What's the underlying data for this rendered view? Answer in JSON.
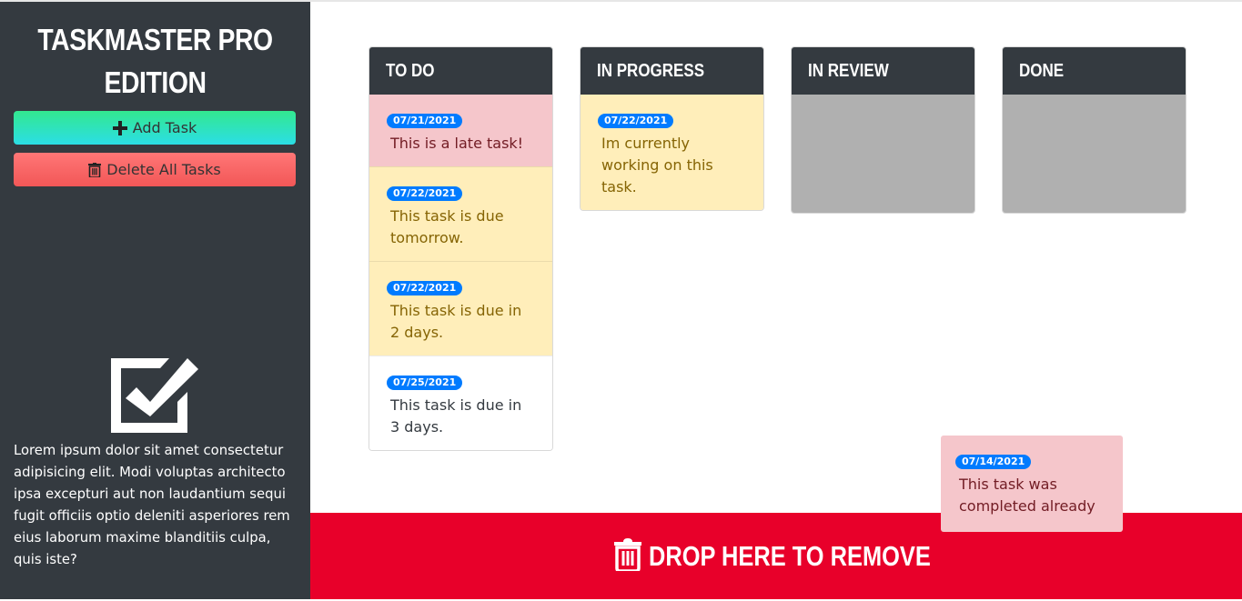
{
  "app": {
    "title_line1": "TASKMASTER PRO",
    "title_line2": "EDITION"
  },
  "sidebar": {
    "add_label": "Add Task",
    "delete_label": "Delete All Tasks",
    "description": "Lorem ipsum dolor sit amet consectetur adipisicing elit. Modi voluptas architecto ipsa excepturi aut non laudantium sequi fugit officiis optio deleniti asperiores rem eius laborum maxime blanditiis culpa, quis iste?"
  },
  "columns": [
    {
      "title": "TO DO",
      "cards": [
        {
          "date": "07/21/2021",
          "text": "This is a late task!",
          "status": "late"
        },
        {
          "date": "07/22/2021",
          "text": "This task is due tomorrow.",
          "status": "soon"
        },
        {
          "date": "07/22/2021",
          "text": "This task is due in 2 days.",
          "status": "soon"
        },
        {
          "date": "07/25/2021",
          "text": "This task is due in 3 days.",
          "status": "ok"
        }
      ]
    },
    {
      "title": "IN PROGRESS",
      "cards": [
        {
          "date": "07/22/2021",
          "text": "Im currently working on this task.",
          "status": "soon"
        }
      ]
    },
    {
      "title": "IN REVIEW",
      "cards": []
    },
    {
      "title": "DONE",
      "cards": []
    }
  ],
  "dragging_card": {
    "date": "07/14/2021",
    "text": "This task was completed already"
  },
  "drop_zone": {
    "label": "DROP HERE TO REMOVE"
  },
  "icons": {
    "add": "plus-icon",
    "delete": "trash-icon",
    "logo": "checkbox-icon",
    "drop": "trash-icon"
  },
  "colors": {
    "sidebar": "#343a40",
    "late": "#f5c6cb",
    "soon": "#ffeeba",
    "badge": "#007bff",
    "drop_zone": "#e8002a",
    "empty_column": "#b0b0b0"
  }
}
